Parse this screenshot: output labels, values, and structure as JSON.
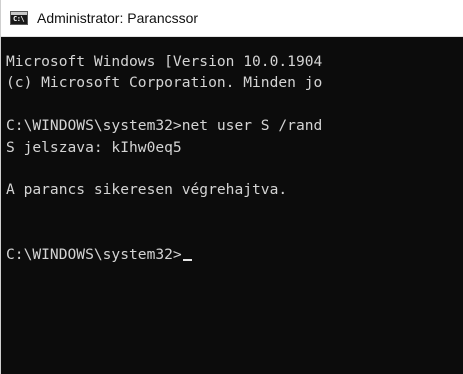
{
  "window": {
    "title": "Administrator: Parancssor",
    "icon": "cmd-console-icon",
    "icon_glyph": "C:\\",
    "background_color": "#0c0c0c",
    "text_color": "#d4d4d4"
  },
  "console": {
    "lines": [
      "Microsoft Windows [Version 10.0.1904",
      "(c) Microsoft Corporation. Minden jo",
      "",
      "C:\\WINDOWS\\system32>net user S /rand",
      "S jelszava: kIhw0eq5",
      "",
      "A parancs sikeresen végrehajtva.",
      "",
      ""
    ],
    "prompt": "C:\\WINDOWS\\system32>"
  }
}
